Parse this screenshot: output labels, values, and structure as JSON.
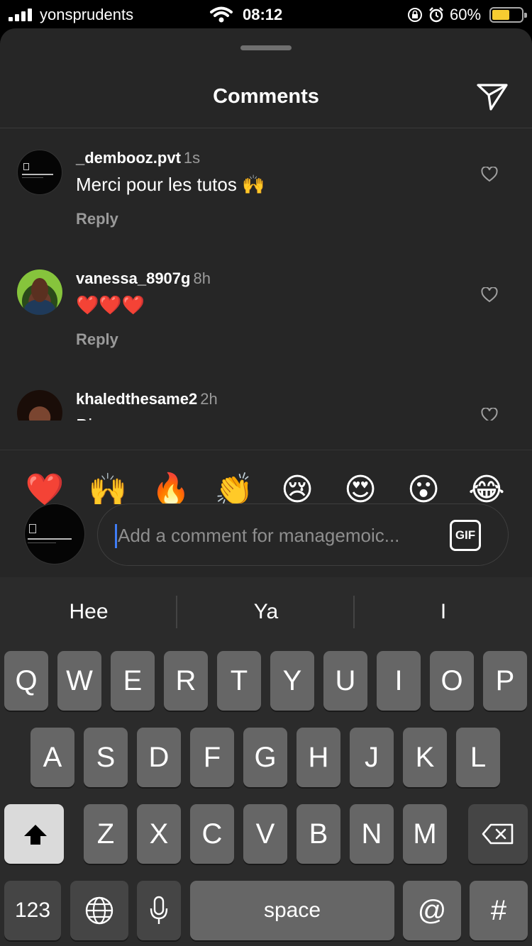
{
  "status_bar": {
    "carrier": "yonsprudents",
    "time": "08:12",
    "battery_percent": "60%",
    "battery_level": 0.6,
    "battery_color": "#f6cc31"
  },
  "sheet": {
    "title": "Comments",
    "share_icon": "paper-plane-icon"
  },
  "comments": [
    {
      "username": "_dembooz.pvt",
      "time": "1s",
      "text": "Merci pour les tutos 🙌",
      "reply_label": "Reply",
      "like_icon": "heart-outline-icon"
    },
    {
      "username": "vanessa_8907g",
      "time": "8h",
      "text": "❤️❤️❤️",
      "reply_label": "Reply",
      "like_icon": "heart-outline-icon"
    },
    {
      "username": "khaledthesame2",
      "time": "2h",
      "text": "Bi",
      "like_icon": "heart-outline-icon"
    }
  ],
  "quick_reactions": [
    "❤️",
    "🙌",
    "🔥",
    "👏",
    "😢",
    "😍",
    "😮",
    "😂"
  ],
  "composer": {
    "placeholder": "Add a comment for managemoic...",
    "gif_label": "GIF",
    "caret_color": "#3f7cf5"
  },
  "keyboard": {
    "suggestions": [
      "Hee",
      "Ya",
      "I"
    ],
    "row1": [
      "Q",
      "W",
      "E",
      "R",
      "T",
      "Y",
      "U",
      "I",
      "O",
      "P"
    ],
    "row2": [
      "A",
      "S",
      "D",
      "F",
      "G",
      "H",
      "J",
      "K",
      "L"
    ],
    "row3": [
      "Z",
      "X",
      "C",
      "V",
      "B",
      "N",
      "M"
    ],
    "numbers_label": "123",
    "space_label": "space",
    "at_label": "@",
    "hash_label": "#"
  }
}
